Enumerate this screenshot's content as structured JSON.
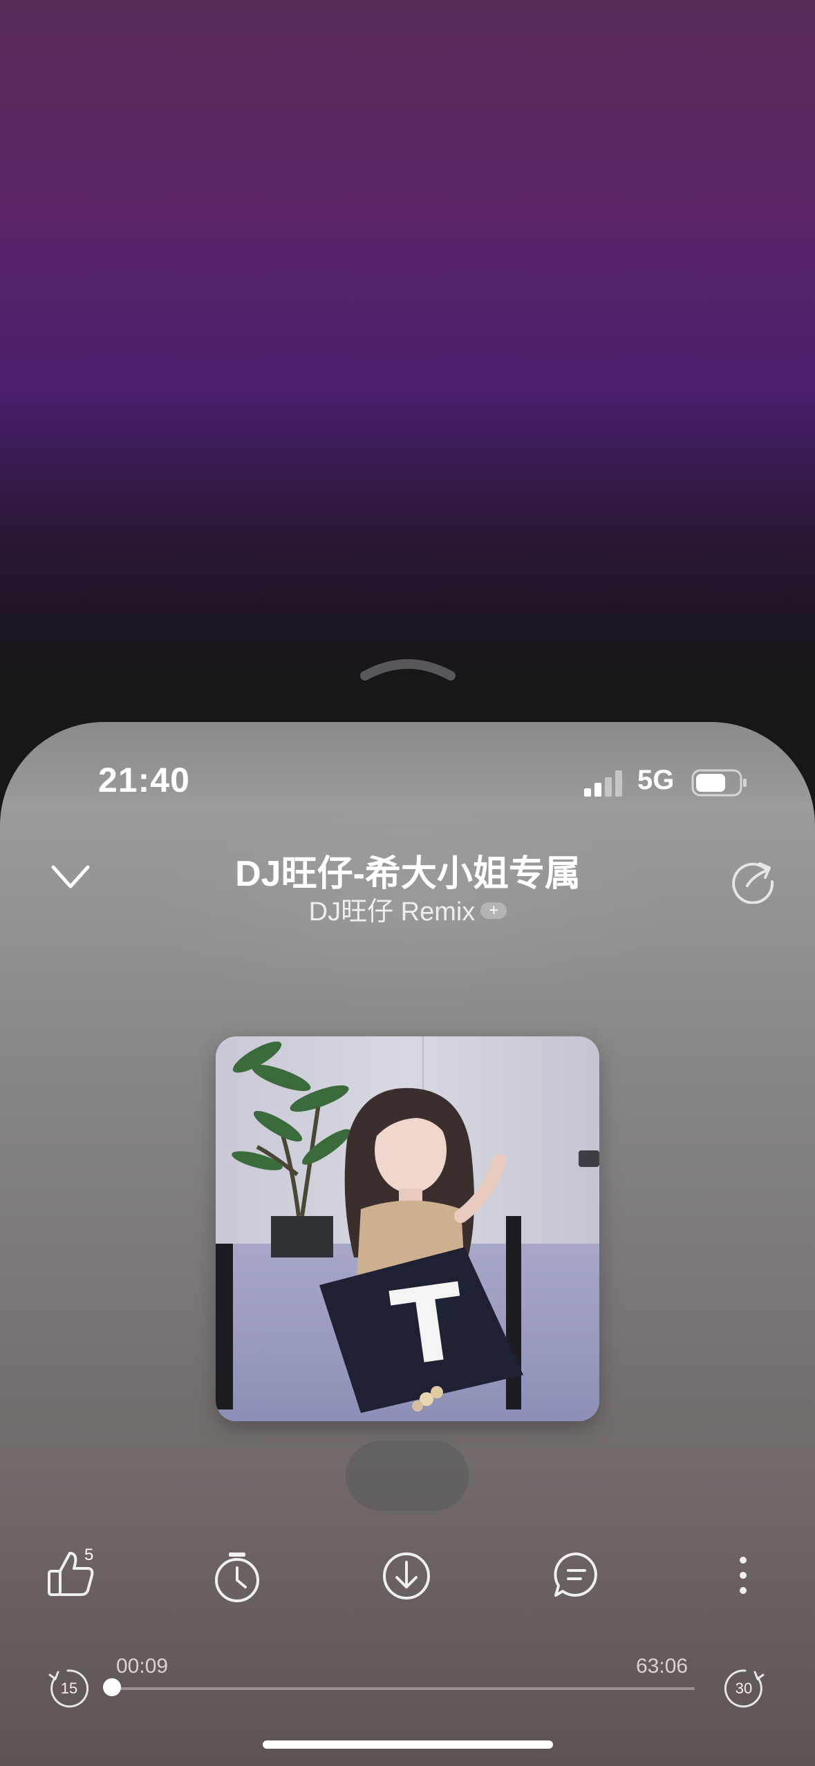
{
  "status_bar": {
    "time": "21:40",
    "network": "5G",
    "signal_bars": 2,
    "battery_level": 0.7
  },
  "player": {
    "song_title": "DJ旺仔-希大小姐专属",
    "artist": "DJ旺仔 Remix",
    "follow_badge": "+",
    "like_count": "5",
    "elapsed": "00:09",
    "duration": "63:06",
    "progress_fraction": 0.0024,
    "skip_back_seconds": "15",
    "skip_forward_seconds": "30"
  },
  "cover_art": {
    "pillow_letter": "T"
  },
  "icons": {
    "pull_up": "chevron-up-icon",
    "collapse": "chevron-down-icon",
    "refresh": "refresh-icon",
    "like": "thumbs-up-icon",
    "timer": "timer-icon",
    "download": "download-icon",
    "comment": "comment-icon",
    "more": "more-vertical-icon",
    "rewind": "rewind-15-icon",
    "forward": "forward-30-icon"
  }
}
